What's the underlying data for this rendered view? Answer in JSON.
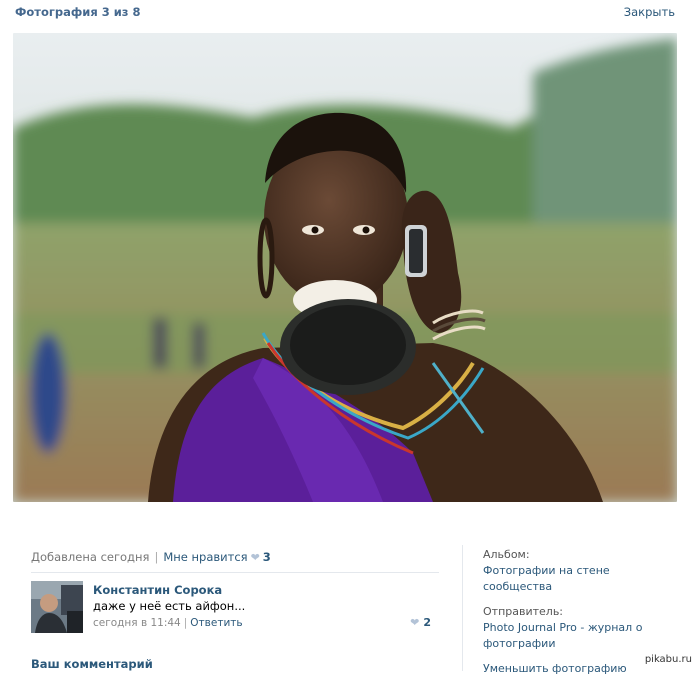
{
  "header": {
    "title": "Фотография 3 из 8",
    "close_label": "Закрыть"
  },
  "photo": {
    "icon": "photo-image"
  },
  "meta": {
    "added": "Добавлена сегодня",
    "separator": "|",
    "like_label": "Мне нравится",
    "like_icon": "heart-icon",
    "like_count": "3"
  },
  "comment": {
    "author": "Константин Сорока",
    "text": "даже у неё есть айфон...",
    "time": "сегодня в 11:44",
    "separator": "|",
    "reply_label": "Ответить",
    "like_count": "2"
  },
  "your_comment_label": "Ваш комментарий",
  "sidebar": {
    "album_label": "Альбом:",
    "album_name_line1": "Фотографии на стене",
    "album_name_line2": "сообщества",
    "sender_label": "Отправитель:",
    "sender_line1": "Photo Journal Pro - журнал о",
    "sender_line2": "фотографии",
    "reduce_label": "Уменьшить фотографию"
  },
  "watermark": "pikabu.ru",
  "colors": {
    "link": "#2b587a",
    "title": "#45688e",
    "muted": "#777777",
    "divider": "#e4e8ed"
  }
}
